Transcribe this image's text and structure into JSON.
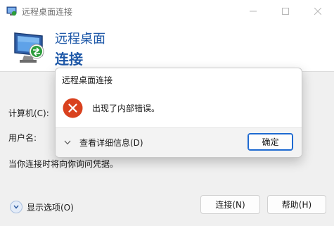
{
  "window": {
    "title": "远程桌面连接",
    "controls": {
      "minimize_icon": "minimize-icon",
      "maximize_icon": "maximize-icon",
      "close_icon": "close-icon"
    }
  },
  "banner": {
    "line1": "远程桌面",
    "line2": "连接",
    "icon": "remote-desktop-icon"
  },
  "form": {
    "computer_label": "计算机(C):",
    "user_label": "用户名:",
    "prompt_text": "当你连接时将向你询问凭据。"
  },
  "footer": {
    "show_options_label": "显示选项(O)",
    "connect_label": "连接(N)",
    "help_label": "帮助(H)"
  },
  "dialog": {
    "title": "远程桌面连接",
    "message": "出现了内部错误。",
    "details_label": "查看详细信息(D)",
    "ok_label": "确定",
    "icon": "error-icon"
  },
  "colors": {
    "banner_text": "#1e58a8",
    "error_red": "#d9411e",
    "default_button_border": "#1e6ad1"
  }
}
